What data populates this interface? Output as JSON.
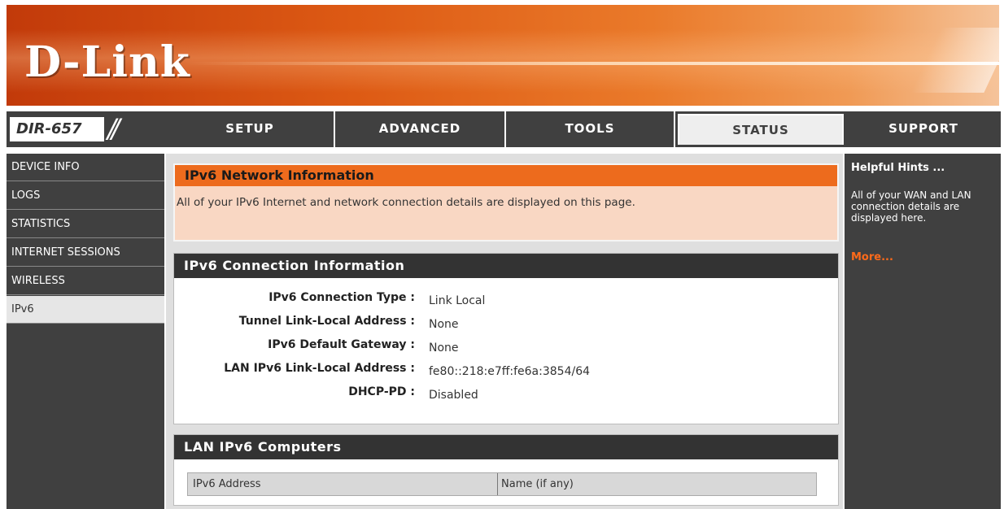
{
  "brand": {
    "logo_text": "D-Link",
    "model": "DIR-657",
    "accent": "#ed6b1d",
    "dark": "#404040"
  },
  "nav": {
    "tabs": [
      {
        "label": "SETUP",
        "active": false
      },
      {
        "label": "ADVANCED",
        "active": false
      },
      {
        "label": "TOOLS",
        "active": false
      },
      {
        "label": "STATUS",
        "active": true
      },
      {
        "label": "SUPPORT",
        "active": false
      }
    ]
  },
  "sidebar": {
    "items": [
      {
        "label": "DEVICE INFO",
        "active": false
      },
      {
        "label": "LOGS",
        "active": false
      },
      {
        "label": "STATISTICS",
        "active": false
      },
      {
        "label": "INTERNET SESSIONS",
        "active": false
      },
      {
        "label": "WIRELESS",
        "active": false
      },
      {
        "label": "IPv6",
        "active": true
      }
    ]
  },
  "network_info": {
    "title": "IPv6 Network Information",
    "description": "All of your IPv6 Internet and network connection details are displayed on this page."
  },
  "connection_info": {
    "title": "IPv6 Connection Information",
    "rows": [
      {
        "label": "IPv6 Connection Type :",
        "value": "Link Local"
      },
      {
        "label": "Tunnel Link-Local Address :",
        "value": "None"
      },
      {
        "label": "IPv6 Default Gateway :",
        "value": "None"
      },
      {
        "label": "LAN IPv6 Link-Local Address :",
        "value": "fe80::218:e7ff:fe6a:3854/64"
      },
      {
        "label": "DHCP-PD :",
        "value": "Disabled"
      }
    ]
  },
  "lan_computers": {
    "title": "LAN IPv6 Computers",
    "columns": [
      "IPv6 Address",
      "Name (if any)"
    ]
  },
  "hints": {
    "title": "Helpful Hints ...",
    "text": "All of your WAN and LAN connection details are displayed here.",
    "more": "More..."
  }
}
